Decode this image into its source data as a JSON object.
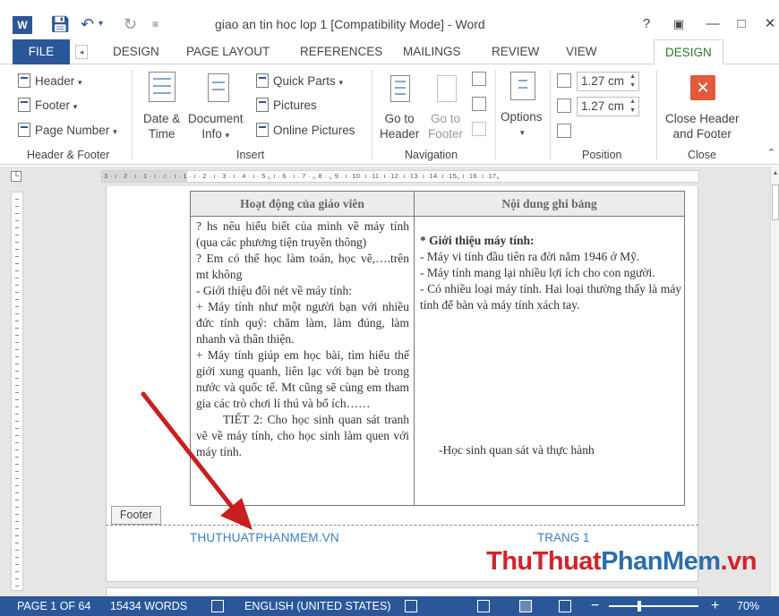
{
  "window": {
    "title": "giao an tin hoc lop 1 [Compatibility Mode] - Word",
    "app_icon": "W",
    "help": "?",
    "controls": [
      "help-icon",
      "ribbon-display-icon",
      "minimize-icon",
      "maximize-icon",
      "close-icon"
    ]
  },
  "tabs": {
    "file": "FILE",
    "design": "DESIGN",
    "page_layout": "PAGE LAYOUT",
    "references": "REFERENCES",
    "mailings": "MAILINGS",
    "review": "REVIEW",
    "view": "VIEW",
    "design_active": "DESIGN"
  },
  "ribbon": {
    "header_footer": {
      "header": "Header",
      "footer": "Footer",
      "page_number": "Page Number",
      "label": "Header & Footer"
    },
    "insert": {
      "date_time_1": "Date &",
      "date_time_2": "Time",
      "document_info_1": "Document",
      "document_info_2": "Info",
      "quick_parts": "Quick Parts",
      "pictures": "Pictures",
      "online_pictures": "Online Pictures",
      "label": "Insert"
    },
    "navigation": {
      "goto_header_1": "Go to",
      "goto_header_2": "Header",
      "goto_footer_1": "Go to",
      "goto_footer_2": "Footer",
      "label": "Navigation"
    },
    "options": {
      "options": "Options"
    },
    "position": {
      "header_from_top": "1.27 cm",
      "footer_from_bottom": "1.27 cm",
      "label": "Position"
    },
    "close": {
      "close_1": "Close Header",
      "close_2": "and Footer",
      "label": "Close"
    }
  },
  "ruler": {
    "text": "3 · ı · 2 · ı · 1 · ı · ⌂ · ı · 1 · ı · 2 · ı · 3 · ı · 4 · ı · 5 ⌞ ı · 6 · ı · 7 · ⌞ 8 · ⌞ 9 · ı ·10· ı ·11· ı ·12· ı ·13· ı ·14· ı ·15⌞ ı ·16· ı ·17⌞"
  },
  "document": {
    "table": {
      "col1_header": "Hoạt động của giáo viên",
      "col2_header": "Nội dung ghi bảng",
      "left_lines": [
        "? hs nêu hiểu biết của mình về máy tính (qua các phương tiện truyền thông)",
        "? Em có thể học làm toán, học vẽ,….trên mt không",
        "- Giới thiệu đôi nét về máy tính:",
        "+ Máy tính như một người bạn với nhiều đức tính quý: chăm làm, làm đúng, làm nhanh và thân thiện.",
        "+ Máy tính giúp em học bài, tìm hiểu thế giới xung quanh, liên lạc với bạn bè trong nước và quốc tế. Mt cũng sẽ cùng em tham gia các trò chơi lí thú và bổ ích……"
      ],
      "left_indented": "TIẾT 2: Cho học sinh quan sát tranh vẽ về máy tính, cho học sinh làm quen với máy tính.",
      "right_title": "* Giới thiệu máy tính:",
      "right_lines": [
        "- Máy vi tính đầu tiên ra đời năm 1946 ở Mỹ.",
        "- Máy tính mang lại nhiều lợi ích cho con người.",
        "- Có nhiều loại máy tính. Hai loại thường thấy là máy tính để bàn và máy tính xách tay."
      ],
      "right_bottom": "-Học sinh quan sát và thực hành"
    },
    "footer_tag": "Footer",
    "footer_left": "THUTHUATPHANMEM.VN",
    "footer_right": "TRANG 1",
    "watermark_red": "ThuThuat",
    "watermark_blue": "PhanMem",
    "watermark_tail": ".vn"
  },
  "statusbar": {
    "page": "PAGE 1 OF 64",
    "words": "15434 WORDS",
    "language": "ENGLISH (UNITED STATES)",
    "zoom": "70%",
    "zoom_minus": "−",
    "zoom_plus": "+"
  },
  "colors": {
    "word_blue": "#2b579a",
    "design_tab_green": "#2b7a2b",
    "footer_text": "#3b7ec2",
    "arrow_red": "#c8201f",
    "close_button": "#e25a3b"
  }
}
